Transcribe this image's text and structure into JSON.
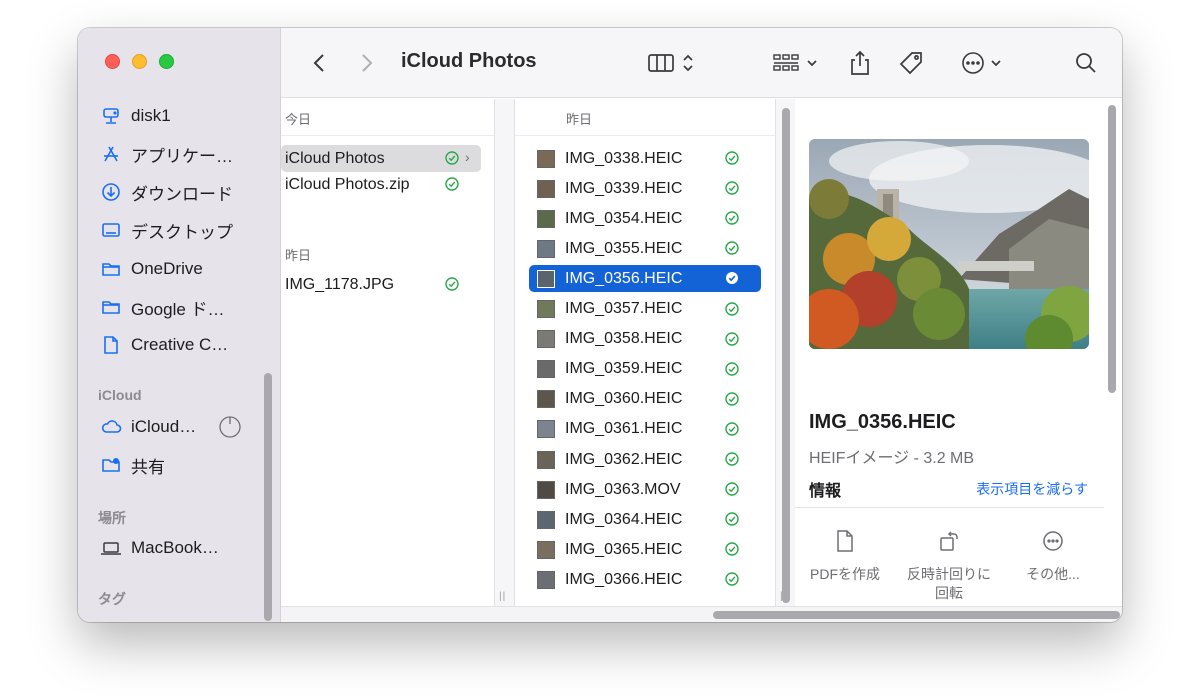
{
  "sidebar": {
    "favorites": [
      {
        "label": "disk1",
        "icon": "external-disk-icon"
      },
      {
        "label": "アプリケー…",
        "icon": "applications-icon"
      },
      {
        "label": "ダウンロード",
        "icon": "downloads-icon"
      },
      {
        "label": "デスクトップ",
        "icon": "desktop-icon"
      },
      {
        "label": "OneDrive",
        "icon": "folder-icon"
      },
      {
        "label": "Google ド…",
        "icon": "folder-icon"
      },
      {
        "label": "Creative C…",
        "icon": "document-icon"
      }
    ],
    "icloud_heading": "iCloud",
    "icloud_items": [
      {
        "label": "iCloud…",
        "icon": "cloud-icon"
      },
      {
        "label": "共有",
        "icon": "shared-folder-icon"
      }
    ],
    "locations_heading": "場所",
    "locations": [
      {
        "label": "MacBook…",
        "icon": "laptop-icon"
      }
    ],
    "tags_heading": "タグ"
  },
  "toolbar": {
    "title": "iCloud Photos"
  },
  "column1": {
    "group_today": "今日",
    "today_items": [
      "iCloud Photos",
      "iCloud Photos.zip"
    ],
    "group_yesterday": "昨日",
    "yesterday_items": [
      "IMG_1178.JPG"
    ]
  },
  "column2": {
    "group": "昨日",
    "items": [
      "IMG_0338.HEIC",
      "IMG_0339.HEIC",
      "IMG_0354.HEIC",
      "IMG_0355.HEIC",
      "IMG_0356.HEIC",
      "IMG_0357.HEIC",
      "IMG_0358.HEIC",
      "IMG_0359.HEIC",
      "IMG_0360.HEIC",
      "IMG_0361.HEIC",
      "IMG_0362.HEIC",
      "IMG_0363.MOV",
      "IMG_0364.HEIC",
      "IMG_0365.HEIC",
      "IMG_0366.HEIC"
    ],
    "selected": "IMG_0356.HEIC"
  },
  "preview": {
    "filename": "IMG_0356.HEIC",
    "kind": "HEIFイメージ - 3.2 MB",
    "info_label": "情報",
    "show_less": "表示項目を減らす",
    "actions": {
      "pdf": "PDFを作成",
      "rotate_line1": "反時計回りに",
      "rotate_line2": "回転",
      "more": "その他..."
    }
  },
  "colors": {
    "selection_blue": "#1463d6",
    "check_green": "#2aa848",
    "link_blue": "#1a6ef5"
  }
}
